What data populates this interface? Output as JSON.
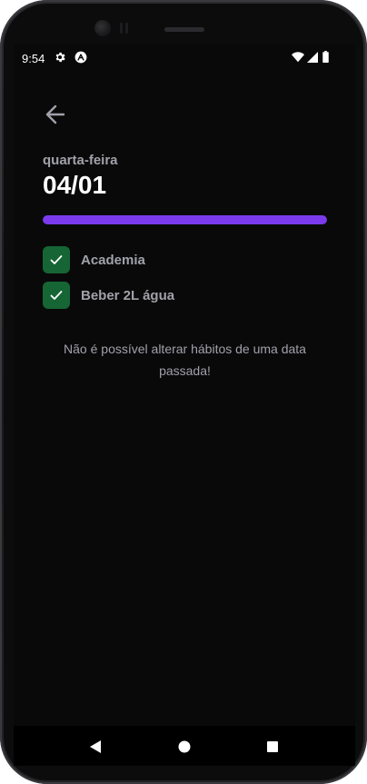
{
  "status_bar": {
    "time": "9:54",
    "icons": [
      "gear-icon",
      "a-logo-icon",
      "wifi-icon",
      "signal-icon",
      "battery-icon"
    ]
  },
  "header": {
    "back_icon": "arrow-left-icon",
    "weekday": "quarta-feira",
    "date": "04/01"
  },
  "progress": {
    "percent": 100,
    "color": "#7c3aed"
  },
  "habits": [
    {
      "label": "Academia",
      "checked": true
    },
    {
      "label": "Beber 2L água",
      "checked": true
    }
  ],
  "notice": "Não é possível alterar hábitos de uma data passada!",
  "colors": {
    "background": "#09090a",
    "checkbox": "#166534",
    "muted_text": "#a1a1aa"
  },
  "nav_bar": {
    "icons": [
      "nav-back-icon",
      "nav-home-icon",
      "nav-recents-icon"
    ]
  }
}
